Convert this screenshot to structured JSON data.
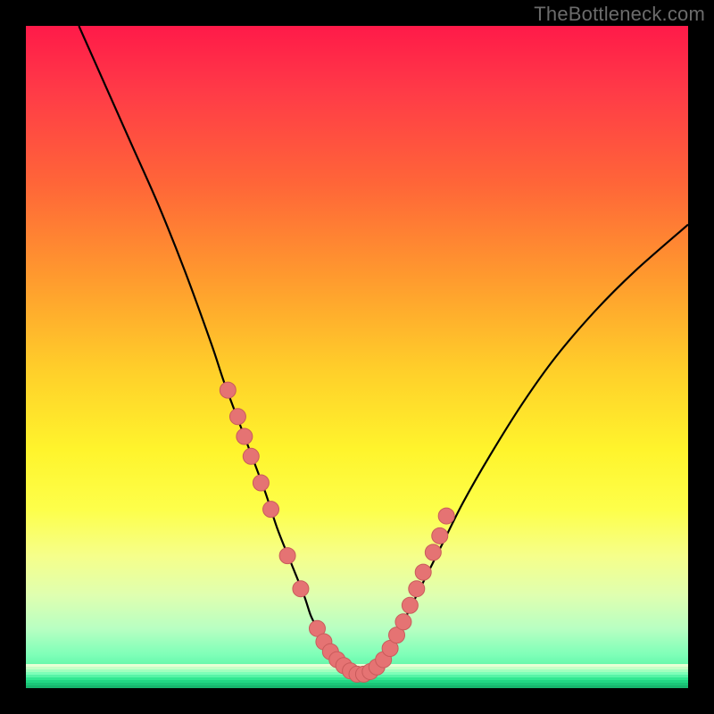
{
  "watermark": "TheBottleneck.com",
  "colors": {
    "curve": "#000000",
    "marker_fill": "#e57373",
    "marker_stroke": "#c95b5b",
    "bands": [
      "#e8ffd4",
      "#c8ffc7",
      "#a3ffbf",
      "#7dffb8",
      "#57f4a7",
      "#33e892",
      "#22d784",
      "#1bc678",
      "#17b56d"
    ]
  },
  "chart_data": {
    "type": "line",
    "title": "",
    "xlabel": "",
    "ylabel": "",
    "xlim": [
      0,
      100
    ],
    "ylim": [
      0,
      100
    ],
    "series": [
      {
        "name": "curve",
        "x": [
          8,
          12,
          16,
          20,
          24,
          28,
          30,
          33,
          36,
          38,
          40,
          42,
          43,
          44,
          45,
          46,
          47,
          48,
          49,
          50,
          51,
          52,
          53,
          54,
          55,
          56,
          58,
          60,
          63,
          66,
          70,
          75,
          80,
          86,
          92,
          100
        ],
        "y": [
          100,
          91,
          82,
          73,
          63,
          52,
          46,
          38,
          30,
          24,
          19,
          14,
          11,
          9,
          7,
          5,
          4,
          3,
          2.3,
          2,
          2.1,
          2.5,
          3.2,
          4.3,
          6,
          8,
          12,
          16,
          22,
          28,
          35,
          43,
          50,
          57,
          63,
          70
        ]
      }
    ],
    "markers": {
      "name": "highlight-points",
      "x": [
        30.5,
        32,
        33,
        34,
        35.5,
        37,
        39.5,
        41.5,
        44,
        45,
        46,
        47,
        48,
        49,
        50,
        51,
        52,
        53,
        54,
        55,
        56,
        57,
        58,
        59,
        60,
        61.5,
        62.5,
        63.5
      ],
      "y": [
        45,
        41,
        38,
        35,
        31,
        27,
        20,
        15,
        9,
        7,
        5.5,
        4.3,
        3.4,
        2.6,
        2.1,
        2.1,
        2.5,
        3.2,
        4.3,
        6,
        8,
        10,
        12.5,
        15,
        17.5,
        20.5,
        23,
        26
      ]
    }
  }
}
